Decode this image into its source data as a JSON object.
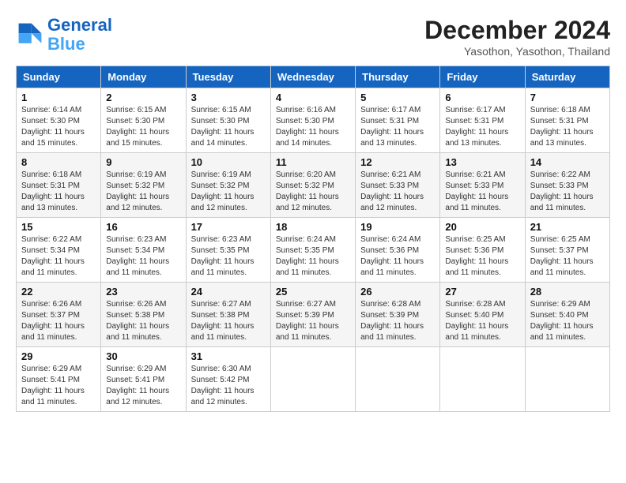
{
  "logo": {
    "line1": "General",
    "line2": "Blue"
  },
  "title": "December 2024",
  "subtitle": "Yasothon, Yasothon, Thailand",
  "header_days": [
    "Sunday",
    "Monday",
    "Tuesday",
    "Wednesday",
    "Thursday",
    "Friday",
    "Saturday"
  ],
  "weeks": [
    [
      {
        "day": "1",
        "sunrise": "6:14 AM",
        "sunset": "5:30 PM",
        "daylight": "11 hours and 15 minutes."
      },
      {
        "day": "2",
        "sunrise": "6:15 AM",
        "sunset": "5:30 PM",
        "daylight": "11 hours and 15 minutes."
      },
      {
        "day": "3",
        "sunrise": "6:15 AM",
        "sunset": "5:30 PM",
        "daylight": "11 hours and 14 minutes."
      },
      {
        "day": "4",
        "sunrise": "6:16 AM",
        "sunset": "5:30 PM",
        "daylight": "11 hours and 14 minutes."
      },
      {
        "day": "5",
        "sunrise": "6:17 AM",
        "sunset": "5:31 PM",
        "daylight": "11 hours and 13 minutes."
      },
      {
        "day": "6",
        "sunrise": "6:17 AM",
        "sunset": "5:31 PM",
        "daylight": "11 hours and 13 minutes."
      },
      {
        "day": "7",
        "sunrise": "6:18 AM",
        "sunset": "5:31 PM",
        "daylight": "11 hours and 13 minutes."
      }
    ],
    [
      {
        "day": "8",
        "sunrise": "6:18 AM",
        "sunset": "5:31 PM",
        "daylight": "11 hours and 13 minutes."
      },
      {
        "day": "9",
        "sunrise": "6:19 AM",
        "sunset": "5:32 PM",
        "daylight": "11 hours and 12 minutes."
      },
      {
        "day": "10",
        "sunrise": "6:19 AM",
        "sunset": "5:32 PM",
        "daylight": "11 hours and 12 minutes."
      },
      {
        "day": "11",
        "sunrise": "6:20 AM",
        "sunset": "5:32 PM",
        "daylight": "11 hours and 12 minutes."
      },
      {
        "day": "12",
        "sunrise": "6:21 AM",
        "sunset": "5:33 PM",
        "daylight": "11 hours and 12 minutes."
      },
      {
        "day": "13",
        "sunrise": "6:21 AM",
        "sunset": "5:33 PM",
        "daylight": "11 hours and 11 minutes."
      },
      {
        "day": "14",
        "sunrise": "6:22 AM",
        "sunset": "5:33 PM",
        "daylight": "11 hours and 11 minutes."
      }
    ],
    [
      {
        "day": "15",
        "sunrise": "6:22 AM",
        "sunset": "5:34 PM",
        "daylight": "11 hours and 11 minutes."
      },
      {
        "day": "16",
        "sunrise": "6:23 AM",
        "sunset": "5:34 PM",
        "daylight": "11 hours and 11 minutes."
      },
      {
        "day": "17",
        "sunrise": "6:23 AM",
        "sunset": "5:35 PM",
        "daylight": "11 hours and 11 minutes."
      },
      {
        "day": "18",
        "sunrise": "6:24 AM",
        "sunset": "5:35 PM",
        "daylight": "11 hours and 11 minutes."
      },
      {
        "day": "19",
        "sunrise": "6:24 AM",
        "sunset": "5:36 PM",
        "daylight": "11 hours and 11 minutes."
      },
      {
        "day": "20",
        "sunrise": "6:25 AM",
        "sunset": "5:36 PM",
        "daylight": "11 hours and 11 minutes."
      },
      {
        "day": "21",
        "sunrise": "6:25 AM",
        "sunset": "5:37 PM",
        "daylight": "11 hours and 11 minutes."
      }
    ],
    [
      {
        "day": "22",
        "sunrise": "6:26 AM",
        "sunset": "5:37 PM",
        "daylight": "11 hours and 11 minutes."
      },
      {
        "day": "23",
        "sunrise": "6:26 AM",
        "sunset": "5:38 PM",
        "daylight": "11 hours and 11 minutes."
      },
      {
        "day": "24",
        "sunrise": "6:27 AM",
        "sunset": "5:38 PM",
        "daylight": "11 hours and 11 minutes."
      },
      {
        "day": "25",
        "sunrise": "6:27 AM",
        "sunset": "5:39 PM",
        "daylight": "11 hours and 11 minutes."
      },
      {
        "day": "26",
        "sunrise": "6:28 AM",
        "sunset": "5:39 PM",
        "daylight": "11 hours and 11 minutes."
      },
      {
        "day": "27",
        "sunrise": "6:28 AM",
        "sunset": "5:40 PM",
        "daylight": "11 hours and 11 minutes."
      },
      {
        "day": "28",
        "sunrise": "6:29 AM",
        "sunset": "5:40 PM",
        "daylight": "11 hours and 11 minutes."
      }
    ],
    [
      {
        "day": "29",
        "sunrise": "6:29 AM",
        "sunset": "5:41 PM",
        "daylight": "11 hours and 11 minutes."
      },
      {
        "day": "30",
        "sunrise": "6:29 AM",
        "sunset": "5:41 PM",
        "daylight": "11 hours and 12 minutes."
      },
      {
        "day": "31",
        "sunrise": "6:30 AM",
        "sunset": "5:42 PM",
        "daylight": "11 hours and 12 minutes."
      },
      null,
      null,
      null,
      null
    ]
  ],
  "labels": {
    "sunrise": "Sunrise:",
    "sunset": "Sunset:",
    "daylight": "Daylight:"
  }
}
